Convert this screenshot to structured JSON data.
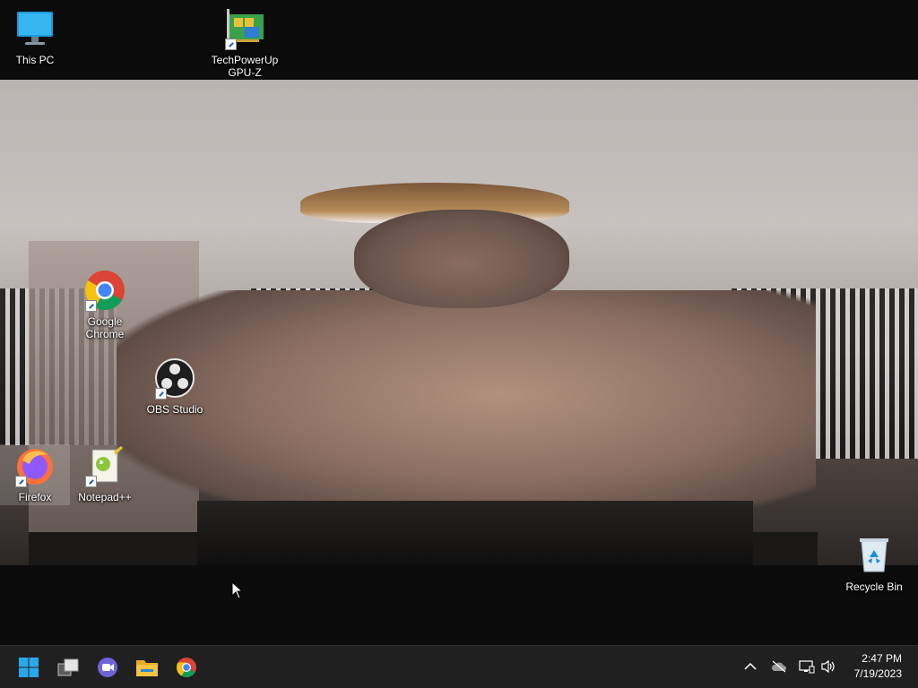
{
  "desktop": {
    "icons": [
      {
        "id": "this-pc",
        "label": "This PC"
      },
      {
        "id": "gpuz",
        "label_line1": "TechPowerUp",
        "label_line2": "GPU-Z"
      },
      {
        "id": "chrome",
        "label_line1": "Google",
        "label_line2": "Chrome"
      },
      {
        "id": "obs",
        "label": "OBS Studio"
      },
      {
        "id": "firefox",
        "label": "Firefox"
      },
      {
        "id": "notepadpp",
        "label": "Notepad++"
      },
      {
        "id": "recycle",
        "label": "Recycle Bin"
      }
    ]
  },
  "taskbar": {
    "pinned": [
      {
        "name": "start-button",
        "icon": "windows-logo-icon"
      },
      {
        "name": "task-view-button",
        "icon": "task-view-icon"
      },
      {
        "name": "chat-button",
        "icon": "teams-chat-icon"
      },
      {
        "name": "file-explorer-button",
        "icon": "folder-icon"
      },
      {
        "name": "chrome-taskbar-button",
        "icon": "chrome-icon"
      }
    ],
    "tray": {
      "time": "2:47 PM",
      "date": "7/19/2023"
    }
  },
  "colors": {
    "taskbar_bg": "#202020",
    "desktop_bg": "#0b0b0c",
    "accent": "#0a84d8"
  }
}
